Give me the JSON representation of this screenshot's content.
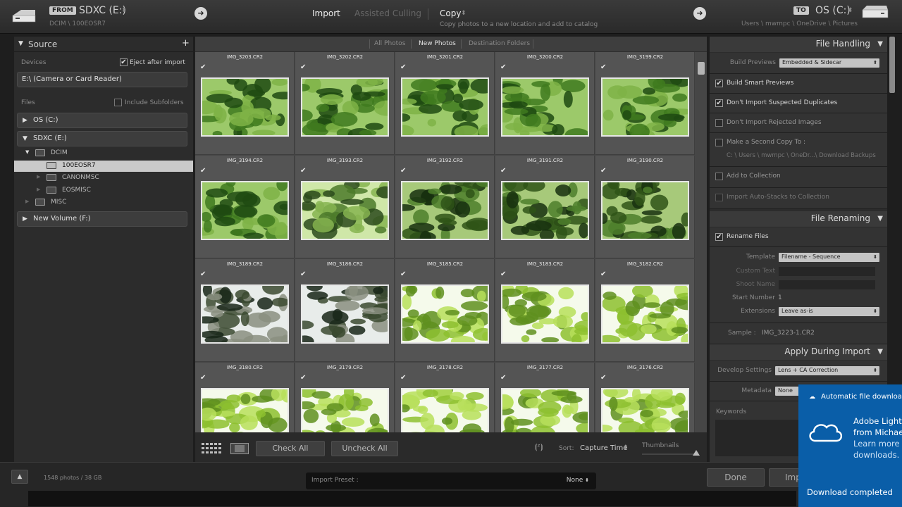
{
  "header": {
    "from_tag": "FROM",
    "from_drive": "SDXC (E:)",
    "from_path": "DCIM \\ 100EOSR7",
    "modes": {
      "import": "Import",
      "assisted_culling": "Assisted Culling",
      "copy": "Copy"
    },
    "copy_sub": "Copy photos to a new location and add to catalog",
    "to_tag": "TO",
    "to_drive": "OS (C:)",
    "to_path": "Users \\ mwmpc \\ OneDrive \\ Pictures"
  },
  "source": {
    "title": "Source",
    "devices_label": "Devices",
    "eject_label": "Eject after import",
    "device_name": "E:\\ (Camera or Card Reader)",
    "files_label": "Files",
    "include_subfolders": "Include Subfolders",
    "volumes": [
      "OS (C:)",
      "SDXC (E:)",
      "New Volume (F:)"
    ],
    "tree": [
      {
        "label": "DCIM"
      },
      {
        "label": "100EOSR7",
        "selected": true
      },
      {
        "label": "CANONMSC"
      },
      {
        "label": "EOSMISC"
      },
      {
        "label": "MISC"
      }
    ]
  },
  "tabs": [
    "All Photos",
    "New Photos",
    "Destination Folders"
  ],
  "grid": {
    "rows": [
      [
        "IMG_3203.CR2",
        "IMG_3202.CR2",
        "IMG_3201.CR2",
        "IMG_3200.CR2",
        "IMG_3199.CR2"
      ],
      [
        "IMG_3194.CR2",
        "IMG_3193.CR2",
        "IMG_3192.CR2",
        "IMG_3191.CR2",
        "IMG_3190.CR2"
      ],
      [
        "IMG_3189.CR2",
        "IMG_3186.CR2",
        "IMG_3185.CR2",
        "IMG_3183.CR2",
        "IMG_3182.CR2"
      ],
      [
        "IMG_3180.CR2",
        "IMG_3179.CR2",
        "IMG_3178.CR2",
        "IMG_3177.CR2",
        "IMG_3176.CR2"
      ]
    ],
    "check_mark": "✔"
  },
  "toolbar": {
    "check_all": "Check All",
    "uncheck_all": "Uncheck All",
    "sort_label": "Sort:",
    "sort_value": "Capture Time",
    "thumbnails_label": "Thumbnails"
  },
  "file_handling": {
    "title": "File Handling",
    "build_previews_label": "Build Previews",
    "build_previews_value": "Embedded & Sidecar",
    "options": [
      {
        "label": "Build Smart Previews",
        "checked": true
      },
      {
        "label": "Don't Import Suspected Duplicates",
        "checked": true
      },
      {
        "label": "Don't Import Rejected Images",
        "checked": false
      },
      {
        "label": "Make a Second Copy To :",
        "checked": false
      },
      {
        "label": "Add to Collection",
        "checked": false
      },
      {
        "label": "Import Auto-Stacks to Collection",
        "checked": false
      }
    ],
    "second_copy_path": "C: \\ Users \\ mwmpc \\ OneDr...\\ Download Backups"
  },
  "file_renaming": {
    "title": "File Renaming",
    "rename_files": "Rename Files",
    "template_label": "Template",
    "template_value": "Filename - Sequence",
    "custom_text_label": "Custom Text",
    "shoot_name_label": "Shoot Name",
    "start_number_label": "Start Number",
    "start_number_value": "1",
    "extensions_label": "Extensions",
    "extensions_value": "Leave as-is",
    "sample_label": "Sample :",
    "sample_value": "IMG_3223-1.CR2"
  },
  "apply_during_import": {
    "title": "Apply During Import",
    "develop_label": "Develop Settings",
    "develop_value": "Lens + CA Correction",
    "metadata_label": "Metadata",
    "metadata_value": "None",
    "keywords_label": "Keywords"
  },
  "bottom": {
    "stats": "1548 photos / 38 GB",
    "preset_label": "Import Preset :",
    "preset_value": "None",
    "done": "Done",
    "import": "Imp"
  },
  "toast": {
    "title": "Automatic file downloads",
    "line1": "Adobe Lightr",
    "line2": "from Michae",
    "line3": "Learn more i",
    "line4": "downloads.",
    "footer": "Download completed"
  }
}
